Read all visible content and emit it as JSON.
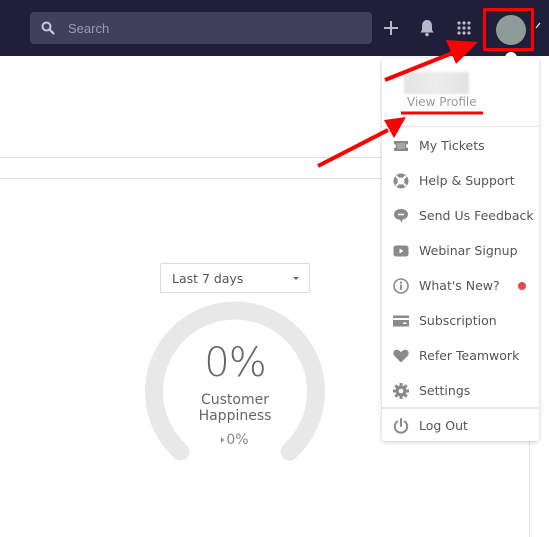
{
  "topbar": {
    "search_placeholder": "Search",
    "icons": [
      "search-icon",
      "plus-icon",
      "bell-icon",
      "apps-grid-icon",
      "avatar",
      "chevron-down-icon"
    ]
  },
  "filter": {
    "date_range": "Last 7 days"
  },
  "gauge": {
    "value": "0%",
    "label_line1": "Customer",
    "label_line2": "Happiness",
    "change": "0%",
    "fraction": 0
  },
  "profile_menu": {
    "view_profile": "View Profile",
    "items": [
      {
        "label": "My Tickets",
        "icon": "ticket-icon"
      },
      {
        "label": "Help & Support",
        "icon": "lifebuoy-icon"
      },
      {
        "label": "Send Us Feedback",
        "icon": "chat-bubble-icon"
      },
      {
        "label": "Webinar Signup",
        "icon": "video-play-icon"
      },
      {
        "label": "What's New?",
        "icon": "info-icon",
        "badge": true
      },
      {
        "label": "Subscription",
        "icon": "credit-card-icon"
      },
      {
        "label": "Refer Teamwork",
        "icon": "heart-icon"
      },
      {
        "label": "Settings",
        "icon": "gear-icon"
      },
      {
        "label": "Log Out",
        "icon": "power-icon"
      }
    ]
  },
  "colors": {
    "topbar_bg": "#1f1f3a",
    "search_bg": "#403f5c",
    "annotation_red": "#ff0000",
    "badge_red": "#e04b4b",
    "gauge_track": "#e8e8e8"
  }
}
